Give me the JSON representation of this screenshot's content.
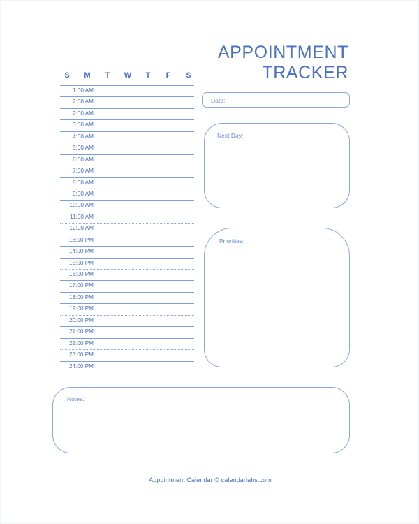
{
  "header": {
    "title_line1": "APPOINTMENT",
    "title_line2": "TRACKER"
  },
  "colors": {
    "accent": "#4a6fc4",
    "line": "#7e9ede",
    "line_dotted": "#90abe4",
    "box_border": "#8aa7e0",
    "label": "#6a8ad4",
    "page_border": "#f2f4f9"
  },
  "schedule": {
    "day_letters": [
      "S",
      "M",
      "T",
      "W",
      "T",
      "F",
      "S"
    ],
    "rows": [
      {
        "time": "1:00 AM",
        "rule": "solid"
      },
      {
        "time": "2:00 AM",
        "rule": "solid"
      },
      {
        "time": "2:00 AM",
        "rule": "solid"
      },
      {
        "time": "3:00 AM",
        "rule": "solid"
      },
      {
        "time": "4:00 AM",
        "rule": "solid"
      },
      {
        "time": "5:00 AM",
        "rule": "dotted"
      },
      {
        "time": "6:00 AM",
        "rule": "solid"
      },
      {
        "time": "7:00 AM",
        "rule": "solid"
      },
      {
        "time": "8:00 AM",
        "rule": "solid"
      },
      {
        "time": "9:00 AM",
        "rule": "dotted"
      },
      {
        "time": "10:00 AM",
        "rule": "solid"
      },
      {
        "time": "11:00 AM",
        "rule": "solid"
      },
      {
        "time": "12:00 AM",
        "rule": "dotted"
      },
      {
        "time": "13:00 PM",
        "rule": "solid"
      },
      {
        "time": "14:00 PM",
        "rule": "solid"
      },
      {
        "time": "15:00 PM",
        "rule": "solid"
      },
      {
        "time": "16:00 PM",
        "rule": "dotted"
      },
      {
        "time": "17:00 PM",
        "rule": "solid"
      },
      {
        "time": "18:00 PM",
        "rule": "solid"
      },
      {
        "time": "19:00 PM",
        "rule": "solid"
      },
      {
        "time": "20:00 PM",
        "rule": "dotted"
      },
      {
        "time": "21:00 PM",
        "rule": "solid"
      },
      {
        "time": "22:00 PM",
        "rule": "solid"
      },
      {
        "time": "23:00 PM",
        "rule": "dotted"
      },
      {
        "time": "24:00 PM",
        "rule": "solid"
      }
    ]
  },
  "fields": {
    "date": {
      "label": "Date:",
      "value": ""
    },
    "next_day": {
      "label": "Next Day:",
      "value": ""
    },
    "priorities": {
      "label": "Priorities:",
      "value": ""
    },
    "notes": {
      "label": "Notes:",
      "value": ""
    }
  },
  "footer": {
    "text": "Appointment Calendar © calendarlabs.com"
  }
}
